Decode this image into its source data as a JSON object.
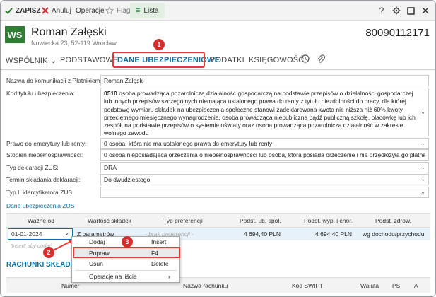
{
  "toolbar": {
    "save": "ZAPISZ",
    "cancel": "Anuluj",
    "operations": "Operacje",
    "flag": "Flaga",
    "list": "Lista",
    "help": "?"
  },
  "header": {
    "badge": "WS",
    "name": "Roman Załęski",
    "address": "Nowiecka 23, 52-119 Wrocław",
    "number": "80090112171"
  },
  "tabs": [
    {
      "label": "WSPÓLNIK ⌄"
    },
    {
      "label": "PODSTAWOWE"
    },
    {
      "label": "DANE UBEZPIECZENIOWE"
    },
    {
      "label": "PODATKI"
    },
    {
      "label": "KSIĘGOWOŚĆ"
    }
  ],
  "callouts": {
    "one": "1",
    "two": "2",
    "three": "3"
  },
  "form": {
    "comm_name_label": "Nazwa do komunikacji z Płatnikiem:",
    "comm_name_value": "Roman Załęski",
    "insurance_code_label": "Kod tytułu ubezpieczenia:",
    "insurance_code_code": "0510",
    "insurance_code_text": "osoba prowadząca pozarolniczą działalność gospodarczą na podstawie przepisów o działalności gospodarczej lub innych przepisów szczególnych niemająca ustalonego prawa do renty z tytułu niezdolności do pracy, dla której podstawę wymiaru składek na ubezpieczenia społeczne stanowi zadeklarowana kwota nie niższa niż 60% kwoty przeciętnego miesięcznego wynagrodzenia, osoba prowadząca niepubliczną bądź publiczną szkołę, placówkę lub ich zespół, na podstawie przepisów o systemie oświaty oraz osoba prowadząca pozarolniczą działalność w zakresie wolnego zawodu",
    "pension_label": "Prawo do emerytury lub renty:",
    "pension_value": "0  osoba, która nie ma ustalonego prawa do emerytury lub renty",
    "disability_label": "Stopień niepełnosprawności:",
    "disability_value": "0  osoba nieposiadająca orzeczenia o niepełnosprawności lub osoba, która posiada orzeczenie i nie przedłożyła go płatnik...",
    "decl_type_label": "Typ deklaracji ZUS:",
    "decl_type_value": "DRA",
    "deadline_label": "Termin składania deklaracji:",
    "deadline_value": "Do dwudziestego",
    "id_type_label": "Typ II identyfikatora ZUS:",
    "id_type_value": ""
  },
  "insurance_section": {
    "title": "Dane ubezpieczenia ZUS",
    "columns": [
      "Ważne od",
      "Wartość składek",
      "Typ preferencji",
      "Podst. ub. społ.",
      "Podst. wyp. i chor.",
      "Podst. zdrow."
    ],
    "row": {
      "valid_from": "01-01-2024",
      "contributions": "Z parametrów",
      "preference": "- brak preferencji -",
      "social_base": "4 694,40 PLN",
      "sickness_base": "4 694,40 PLN",
      "health_base": "wg dochodu/przychodu"
    },
    "hint": "'Insert' aby dodać"
  },
  "context_menu": {
    "items": [
      {
        "label": "Dodaj",
        "shortcut": "Insert"
      },
      {
        "label": "Popraw",
        "shortcut": "F4"
      },
      {
        "label": "Usuń",
        "shortcut": "Delete"
      },
      {
        "label": "Operacje na liście",
        "shortcut": "›"
      }
    ]
  },
  "accounts": {
    "title": "RACHUNKI SKŁADEK",
    "columns": [
      "Numer",
      "Nazwa rachunku",
      "Kod SWIFT",
      "Waluta",
      "PS",
      "A"
    ]
  },
  "colors": {
    "accent": "#0b6fa4",
    "brand": "#2e7d32",
    "highlight": "#e53935"
  }
}
